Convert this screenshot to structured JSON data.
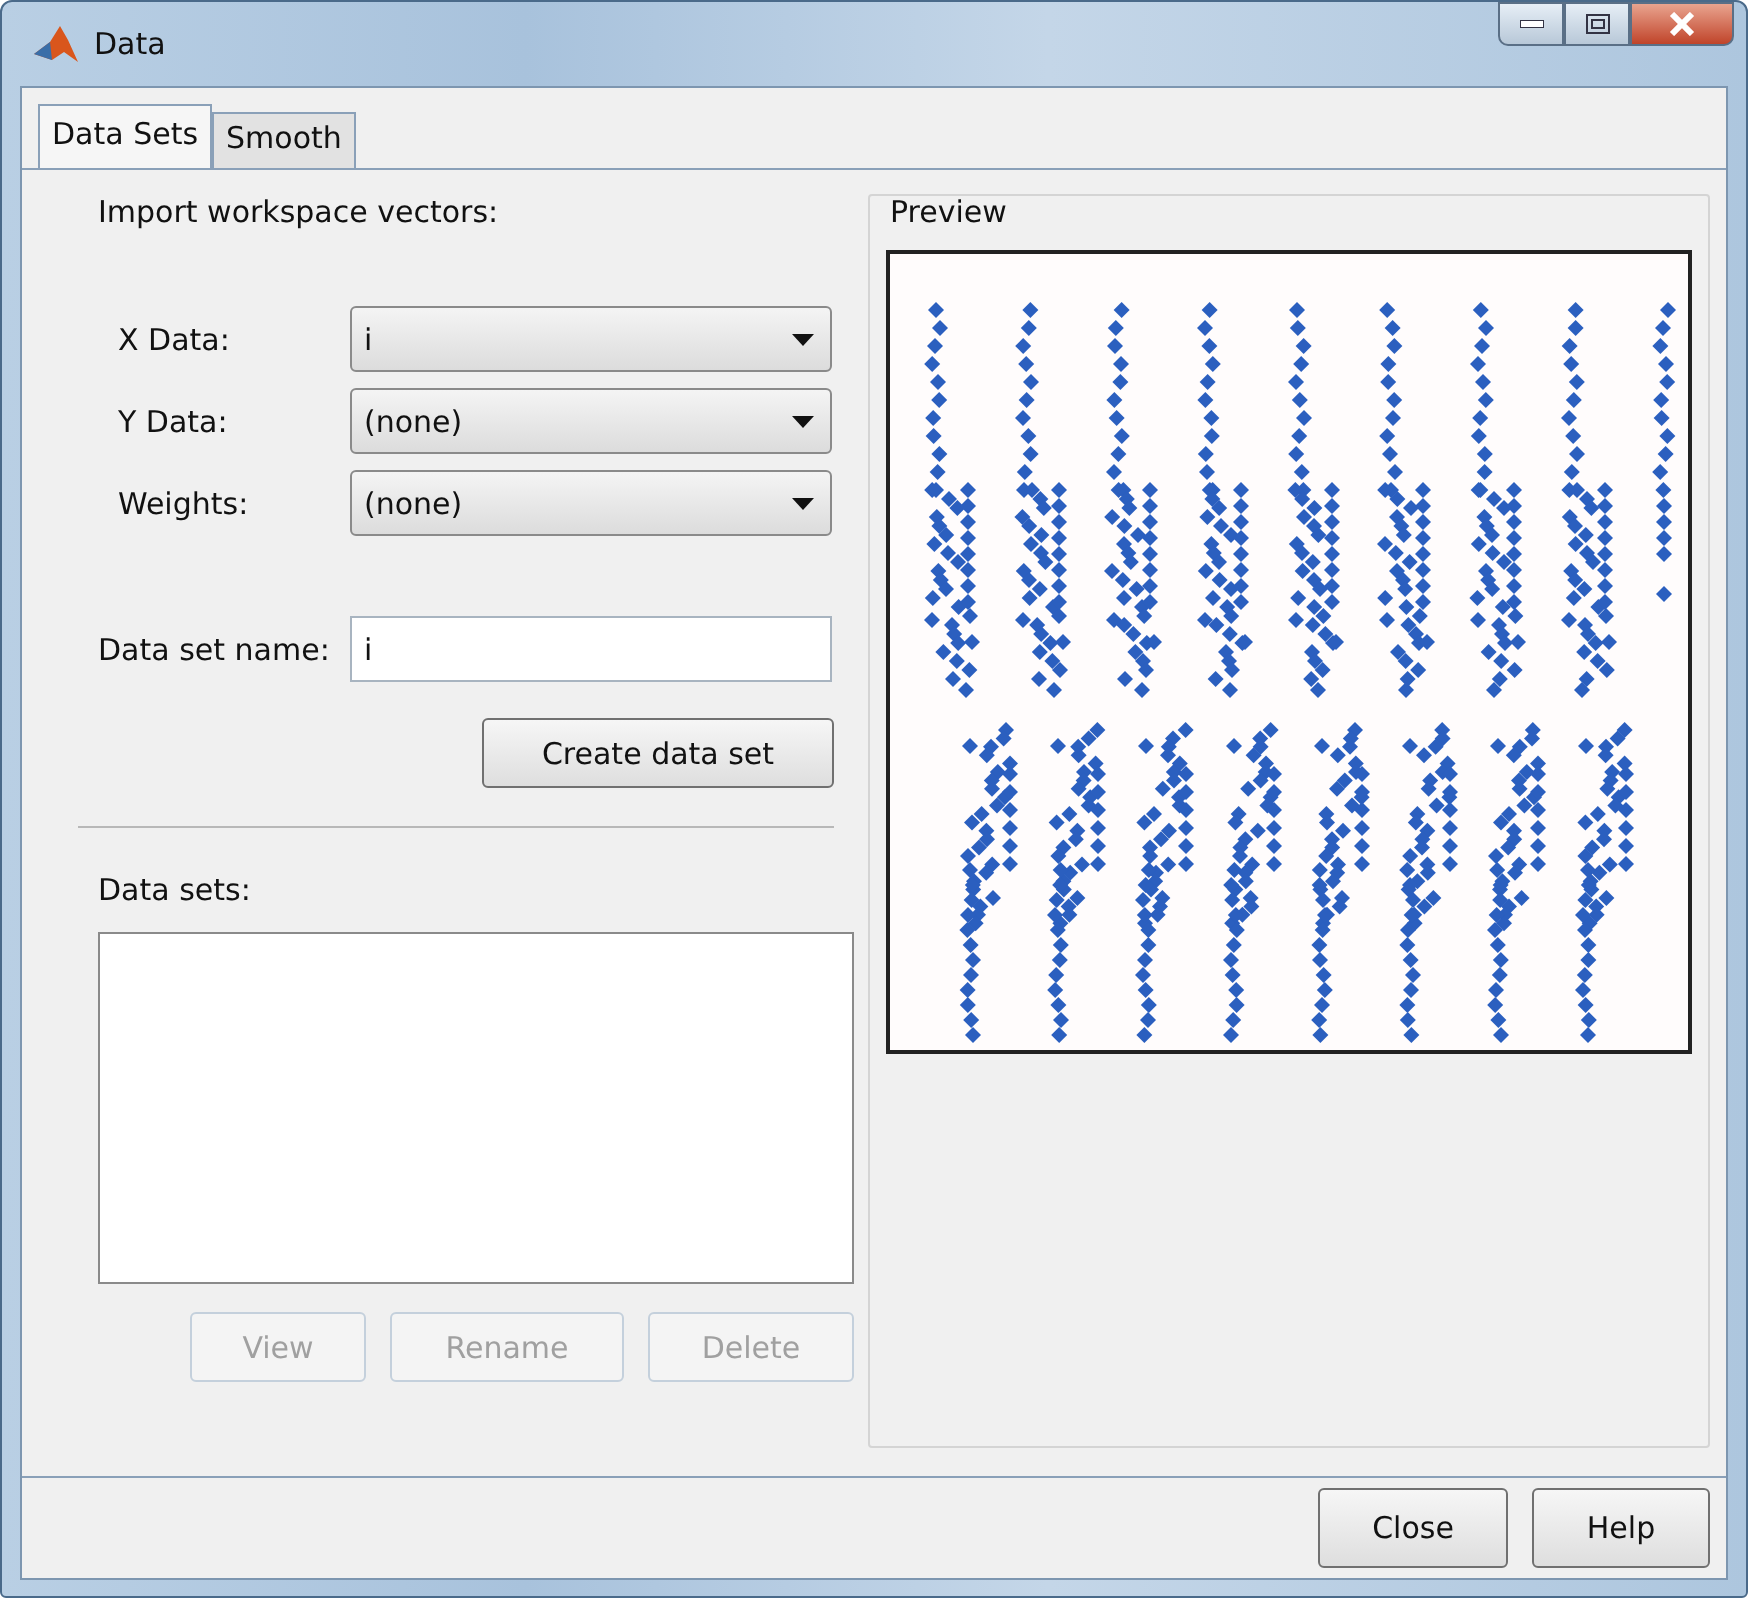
{
  "window": {
    "title": "Data"
  },
  "tabs": [
    {
      "label": "Data Sets",
      "selected": true
    },
    {
      "label": "Smooth",
      "selected": false
    }
  ],
  "import": {
    "heading": "Import workspace vectors:",
    "fields": [
      {
        "label": "X Data:",
        "value": "i"
      },
      {
        "label": "Y Data:",
        "value": "(none)"
      },
      {
        "label": "Weights:",
        "value": "(none)"
      }
    ]
  },
  "data_set_name": {
    "label": "Data set name:",
    "value": "i"
  },
  "create_button": {
    "label": "Create data set",
    "disabled": false
  },
  "data_sets": {
    "label": "Data sets:",
    "buttons": [
      {
        "label": "View",
        "disabled": true
      },
      {
        "label": "Rename",
        "disabled": true
      },
      {
        "label": "Delete",
        "disabled": true
      }
    ]
  },
  "preview": {
    "title": "Preview"
  },
  "buttons": [
    {
      "label": "Close",
      "disabled": false
    },
    {
      "label": "Help",
      "disabled": false
    }
  ]
}
